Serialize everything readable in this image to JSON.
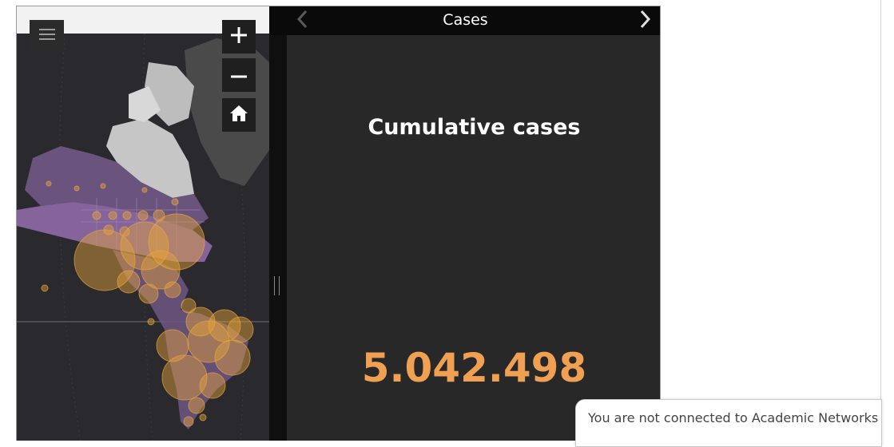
{
  "panel": {
    "header_title": "Cases",
    "title": "Cumulative cases",
    "value": "5.042.498",
    "accent_color": "#f0a053"
  },
  "map": {
    "controls": {
      "menu_icon": "hamburger-menu-icon",
      "zoom_in_icon": "plus-icon",
      "zoom_out_icon": "minus-icon",
      "home_icon": "home-icon"
    },
    "bubble_color": "#e7a53c",
    "region_color": "#8e6aa6"
  },
  "notification": {
    "text": "You are not connected to Academic Networks"
  }
}
